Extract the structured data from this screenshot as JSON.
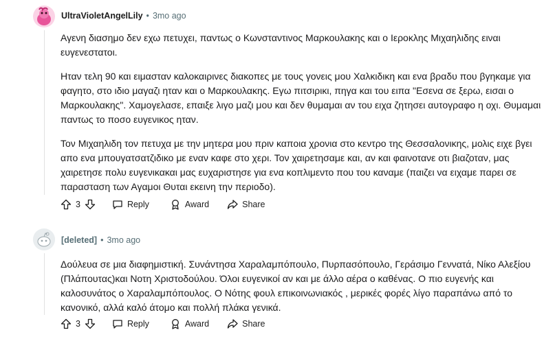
{
  "comments": [
    {
      "author": "UltraVioletAngelLily",
      "time": "3mo ago",
      "paragraphs": [
        "Αγενη διασημο δεν εχω πετυχει, παντως ο Κωνσταντινος Μαρκουλακης και ο Ιεροκλης Μιχαηλιδης ειναι ευγενεστατοι.",
        "Ηταν τελη 90 και ειμασταν καλοκαιρινες διακοπες με τους γονεις μου Χαλκιδικη και ενα βραδυ που βγηκαμε για φαγητο, στο ιδιο μαγαζι ηταν και ο Μαρκουλακης. Εγω πιτσιρικι, πηγα και του ειπα \"Εσενα σε ξερω, εισαι ο Μαρκουλακης\". Χαμογελασε, επαιξε λιγο μαζι μου και δεν θυμαμαι αν του ειχα ζητησει αυτογραφο η οχι. Θυμαμαι παντως το ποσο ευγενικος ηταν.",
        "Τον Μιχαηλιδη τον πετυχα με την μητερα μου πριν καποια χρονια στο κεντρο της Θεσσαλονικης, μολις ειχε βγει απο ενα μπουγατσατζιδικο με εναν καφε στο χερι. Τον χαιρετησαμε και, αν και φαινοτανε οτι βιαζοταν, μας χαιρετησε πολυ ευγενικακαι μας ευχαριστησε για ενα κοπλιμεντο που του καναμε (παιζει να ειχαμε παρει σε παρασταση των Αγαμοι Θυται εκεινη την περιοδο)."
      ],
      "votes": "3",
      "reply_label": "Reply",
      "award_label": "Award",
      "share_label": "Share"
    },
    {
      "author": "[deleted]",
      "time": "3mo ago",
      "paragraphs": [
        "Δούλευα σε μια διαφημιστική. Συνάντησα Χαραλαμπόπουλο, Πυρπασόπουλο, Γεράσιμο Γεννατά, Νίκο Αλεξίου (Πλάπουτας)και Νοτη Χριστοδούλου. Όλοι ευγενικοί αν και με άλλο αέρα ο καθένας. Ο πιο ευγενής και καλοσυνάτος ο Χαραλαμπόπουλος. Ο Νότης φουλ επικοινωνιακός , μερικές φορές λίγο παραπάνω από το κανονικό, αλλά καλό άτομο και πολλή πλάκα γενικά."
      ],
      "votes": "3",
      "reply_label": "Reply",
      "award_label": "Award",
      "share_label": "Share"
    }
  ],
  "icons": {
    "avatar_1": "pink-snoo-avatar",
    "avatar_2": "deleted-user-avatar",
    "upvote": "upvote-arrow-icon",
    "downvote": "downvote-arrow-icon",
    "reply": "speech-bubble-icon",
    "award": "award-medal-icon",
    "share": "share-arrow-icon",
    "more": "overflow-dots-icon"
  },
  "colors": {
    "meta_text": "#576f76",
    "body_text": "#1a1a1b",
    "avatar_pink": "#e8559a"
  }
}
